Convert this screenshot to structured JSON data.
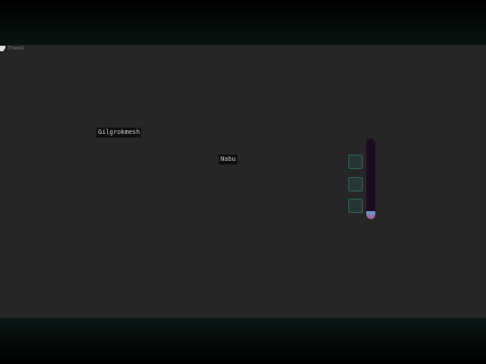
{
  "app": {
    "image_alt": "Travel"
  },
  "scene": {
    "npc_labels": [
      {
        "name": "Gilgrokmesh"
      },
      {
        "name": "Nabu"
      }
    ],
    "inventory_slots": [
      {
        "state": "empty"
      },
      {
        "state": "empty"
      },
      {
        "state": "empty"
      }
    ],
    "vitality_gauge": {
      "level": 0.1,
      "colors": {
        "track": "#1f0a24",
        "fill_top": "#59a2d0",
        "fill_bottom": "#c0508e"
      }
    }
  }
}
